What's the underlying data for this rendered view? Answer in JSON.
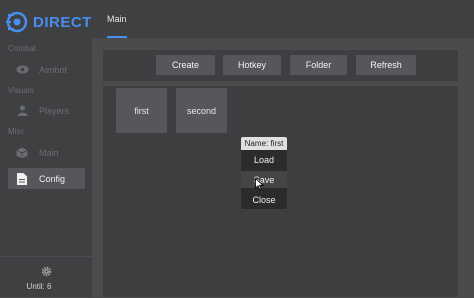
{
  "app": {
    "name": "DIRECT",
    "accent": "#4a8df0"
  },
  "sidebar": {
    "sections": {
      "combat": "Combat",
      "visuals": "Visuals",
      "misc": "Misc"
    },
    "items": [
      {
        "label": "Aimbot",
        "icon": "eye-icon"
      },
      {
        "label": "Players",
        "icon": "user-icon"
      },
      {
        "label": "Main",
        "icon": "cube-icon"
      },
      {
        "label": "Config",
        "icon": "file-icon",
        "active": true
      }
    ],
    "footer": {
      "until": "Until: 6"
    }
  },
  "tabs": [
    {
      "label": "Main",
      "active": true
    }
  ],
  "toolbar": {
    "create": "Create",
    "hotkey": "Hotkey",
    "folder": "Folder",
    "refresh": "Refresh"
  },
  "configs": [
    "first",
    "second"
  ],
  "context_menu": {
    "title": "Name: first",
    "load": "Load",
    "save": "Save",
    "close": "Close"
  }
}
